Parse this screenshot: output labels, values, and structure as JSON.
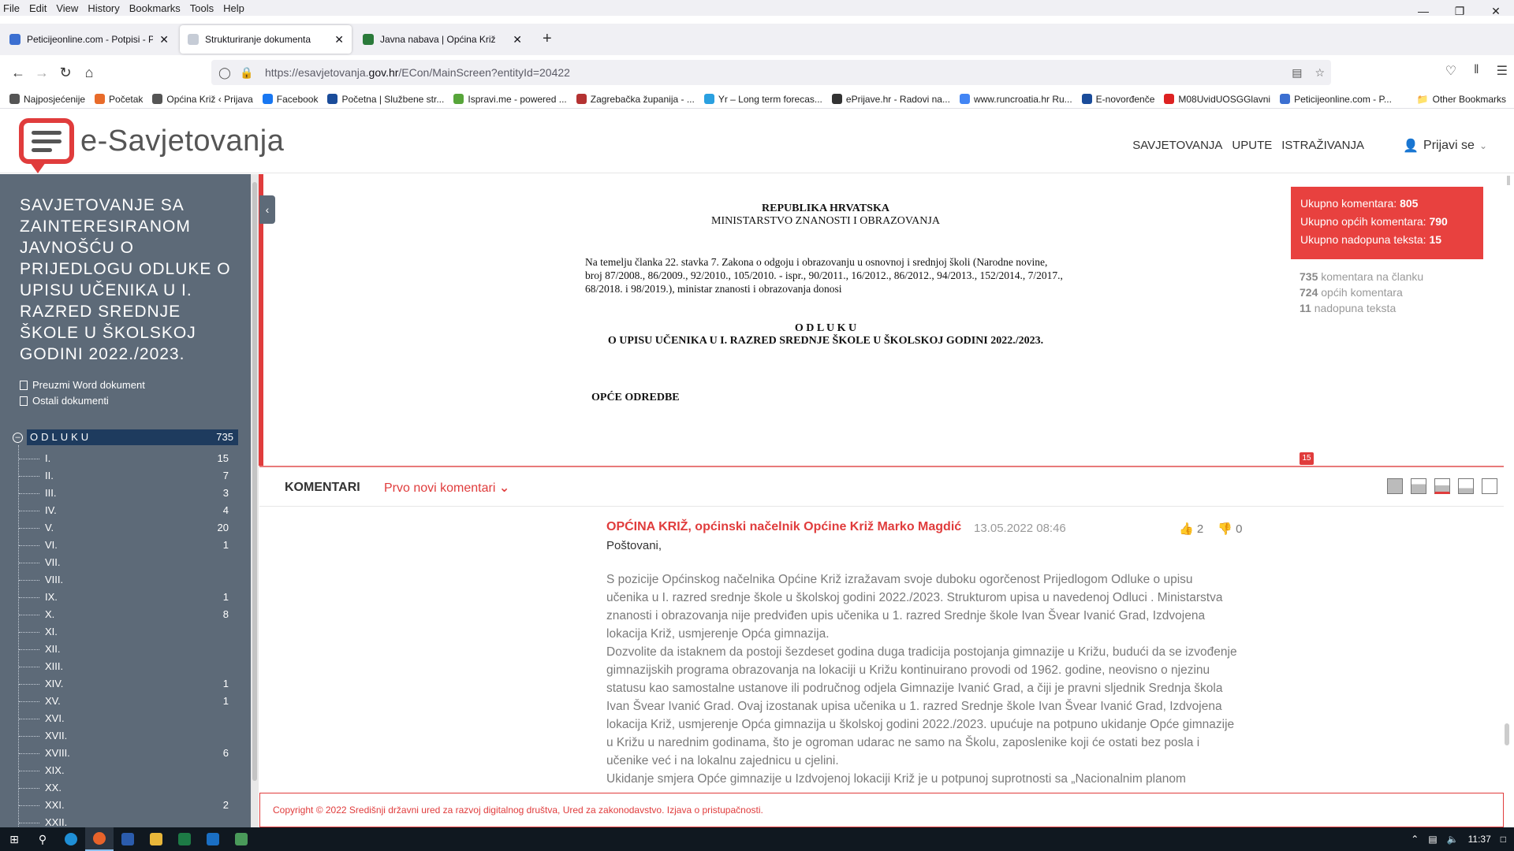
{
  "menubar": [
    "File",
    "Edit",
    "View",
    "History",
    "Bookmarks",
    "Tools",
    "Help"
  ],
  "tabs": [
    {
      "title": "Peticijeonline.com - Potpisi - Pe",
      "color": "#3b6fd1"
    },
    {
      "title": "Strukturiranje dokumenta",
      "color": "#9aa4b4"
    },
    {
      "title": "Javna nabava | Općina Križ",
      "color": "#2a7a3a"
    }
  ],
  "url": {
    "prefix": "https://esavjetovanja.",
    "domain": "gov.hr",
    "rest": "/ECon/MainScreen?entityId=20422"
  },
  "bookmarks": [
    {
      "label": "Najposjećenije",
      "color": "#555"
    },
    {
      "label": "Početak",
      "color": "#e86b2a"
    },
    {
      "label": "Općina Križ ‹ Prijava",
      "color": "#555"
    },
    {
      "label": "Facebook",
      "color": "#1877f2"
    },
    {
      "label": "Početna | Službene str...",
      "color": "#1a4c9a"
    },
    {
      "label": "Ispravi.me - powered ...",
      "color": "#57a53a"
    },
    {
      "label": "Zagrebačka županija - ...",
      "color": "#b43232"
    },
    {
      "label": "Yr – Long term forecas...",
      "color": "#2aa0e0"
    },
    {
      "label": "ePrijave.hr - Radovi na...",
      "color": "#333"
    },
    {
      "label": "www.runcroatia.hr Ru...",
      "color": "#4285f4"
    },
    {
      "label": "E-novorđenče",
      "color": "#1a4c9a"
    },
    {
      "label": "M08UvidUOSGGlavni",
      "color": "#d22"
    },
    {
      "label": "Peticijeonline.com - P...",
      "color": "#3b6fd1"
    }
  ],
  "bookmarks_other": "Other Bookmarks",
  "site": {
    "logo_text": "e-Savjetovanja",
    "nav": [
      "SAVJETOVANJA",
      "UPUTE",
      "ISTRAŽIVANJA"
    ],
    "login": "Prijavi se"
  },
  "sidebar": {
    "title": "SAVJETOVANJE SA ZAINTERESIRANOM JAVNOŠĆU O PRIJEDLOGU ODLUKE O UPISU UČENIKA U I. RAZRED SREDNJE ŠKOLE U ŠKOLSKOJ GODINI 2022./2023.",
    "download_word": "Preuzmi Word dokument",
    "other_docs": "Ostali dokumenti",
    "root": {
      "label": "ODLUKU",
      "count": "735"
    },
    "items": [
      {
        "label": "I.",
        "count": "15"
      },
      {
        "label": "II.",
        "count": "7"
      },
      {
        "label": "III.",
        "count": "3"
      },
      {
        "label": "IV.",
        "count": "4"
      },
      {
        "label": "V.",
        "count": "20"
      },
      {
        "label": "VI.",
        "count": "1"
      },
      {
        "label": "VII.",
        "count": ""
      },
      {
        "label": "VIII.",
        "count": ""
      },
      {
        "label": "IX.",
        "count": "1"
      },
      {
        "label": "X.",
        "count": "8"
      },
      {
        "label": "XI.",
        "count": ""
      },
      {
        "label": "XII.",
        "count": ""
      },
      {
        "label": "XIII.",
        "count": ""
      },
      {
        "label": "XIV.",
        "count": "1"
      },
      {
        "label": "XV.",
        "count": "1"
      },
      {
        "label": "XVI.",
        "count": ""
      },
      {
        "label": "XVII.",
        "count": ""
      },
      {
        "label": "XVIII.",
        "count": "6"
      },
      {
        "label": "XIX.",
        "count": ""
      },
      {
        "label": "XX.",
        "count": ""
      },
      {
        "label": "XXI.",
        "count": "2"
      },
      {
        "label": "XXII.",
        "count": ""
      }
    ]
  },
  "document": {
    "line1": "REPUBLIKA HRVATSKA",
    "line2": "MINISTARSTVO ZNANOSTI I OBRAZOVANJA",
    "preamble": "Na temelju članka 22. stavka 7. Zakona o odgoju i obrazovanju u osnovnoj i srednjoj školi (Narodne novine, broj 87/2008., 86/2009., 92/2010., 105/2010. - ispr., 90/2011., 16/2012., 86/2012., 94/2013., 152/2014., 7/2017., 68/2018. i 98/2019.), ministar znanosti i obrazovanja donosi",
    "odluku": "O D L U K U",
    "subtitle": "O UPISU UČENIKA U I. RAZRED SREDNJE ŠKOLE U ŠKOLSKOJ GODINI 2022./2023.",
    "section": "OPĆE ODREDBE"
  },
  "stats": {
    "total_label": "Ukupno komentara:",
    "total": "805",
    "general_label": "Ukupno općih komentara:",
    "general": "790",
    "amend_label": "Ukupno nadopuna teksta:",
    "amend": "15",
    "article_count": "735",
    "article_label": "komentara na članku",
    "general_count": "724",
    "general_label2": "općih komentara",
    "amend_count": "11",
    "amend_label2": "nadopuna teksta",
    "badge": "15"
  },
  "comments_bar": {
    "label": "KOMENTARI",
    "sort": "Prvo novi komentari"
  },
  "comment": {
    "author": "OPĆINA KRIŽ, općinski načelnik Općine Križ Marko Magdić",
    "date": "13.05.2022 08:46",
    "likes": "2",
    "dislikes": "0",
    "greeting": "Poštovani,",
    "p1": "S pozicije Općinskog načelnika  Općine Križ izražavam svoje duboku ogorčenost Prijedlogom Odluke o upisu učenika u I. razred srednje škole u školskoj godini 2022./2023. Strukturom upisa u navedenoj Odluci . Ministarstva znanosti i obrazovanja nije predviđen upis učenika u 1. razred Srednje škole Ivan Švear Ivanić Grad, Izdvojena lokacija Križ, usmjerenje Opća gimnazija.",
    "p2": "Dozvolite da istaknem da postoji šezdeset godina duga tradicija postojanja gimnazije u Križu, budući da se izvođenje gimnazijskih programa obrazovanja na lokaciji u Križu kontinuirano provodi od 1962. godine, neovisno o njezinu statusu kao samostalne ustanove ili područnog odjela Gimnazije Ivanić Grad, a čiji je pravni sljednik Srednja škola Ivan Švear Ivanić Grad. Ovaj izostanak upisa učenika u 1. razred Srednje škole Ivan Švear Ivanić Grad, Izdvojena lokacija Križ, usmjerenje Opća gimnazija u školskoj godini 2022./2023. upućuje na potpuno ukidanje Opće gimnazije u Križu u narednim godinama, što je ogroman udarac ne samo na Školu, zaposlenike koji će ostati bez posla i učenike već i na lokalnu zajednicu u cjelini.",
    "p3": "Ukidanje smjera Opće gimnazije u Izdvojenoj lokaciji Križ je u potpunoj suprotnosti sa „Nacionalnim planom"
  },
  "footer": "Copyright © 2022 Središnji državni ured za razvoj digitalnog društva, Ured za zakonodavstvo. Izjava o pristupačnosti.",
  "taskbar": {
    "time": "11:37"
  }
}
